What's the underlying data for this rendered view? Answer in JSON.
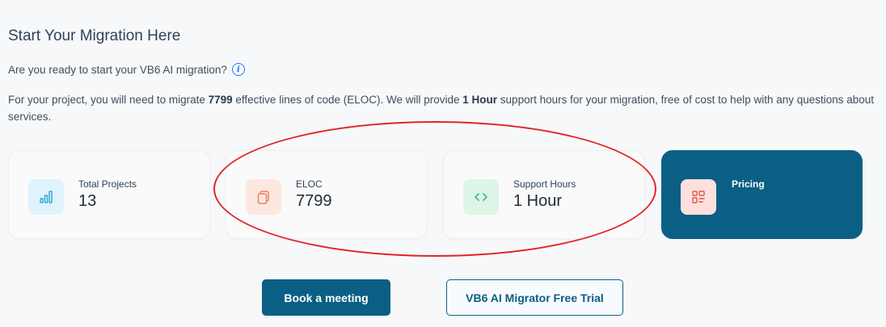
{
  "header": {
    "title": "Start Your Migration Here",
    "question": "Are you ready to start your VB6 AI migration?",
    "info_icon_glyph": "i"
  },
  "description": {
    "part1": "For your project, you will need to migrate ",
    "eloc_value": "7799",
    "part2": " effective lines of code (ELOC). We will provide ",
    "support_value": "1 Hour",
    "part3": " support hours for your migration, free of cost to help with any questions about services."
  },
  "cards": [
    {
      "label": "Total Projects",
      "value": "13",
      "icon": "bar-chart-icon",
      "icon_color": "#2aa3d8",
      "icon_bg": "#dff3fc"
    },
    {
      "label": "ELOC",
      "value": "7799",
      "icon": "copy-icon",
      "icon_color": "#e8835a",
      "icon_bg": "#fde8df"
    },
    {
      "label": "Support Hours",
      "value": "1 Hour",
      "icon": "code-icon",
      "icon_color": "#3fb77a",
      "icon_bg": "#def5e8"
    },
    {
      "label": "Pricing",
      "value": "",
      "icon": "layout-icon",
      "icon_color": "#e2554b",
      "icon_bg": "#fde0dd"
    }
  ],
  "buttons": {
    "book": "Book a meeting",
    "trial": "VB6 AI Migrator Free Trial"
  },
  "colors": {
    "primary": "#0b5f84",
    "highlight": "#e0252a"
  }
}
